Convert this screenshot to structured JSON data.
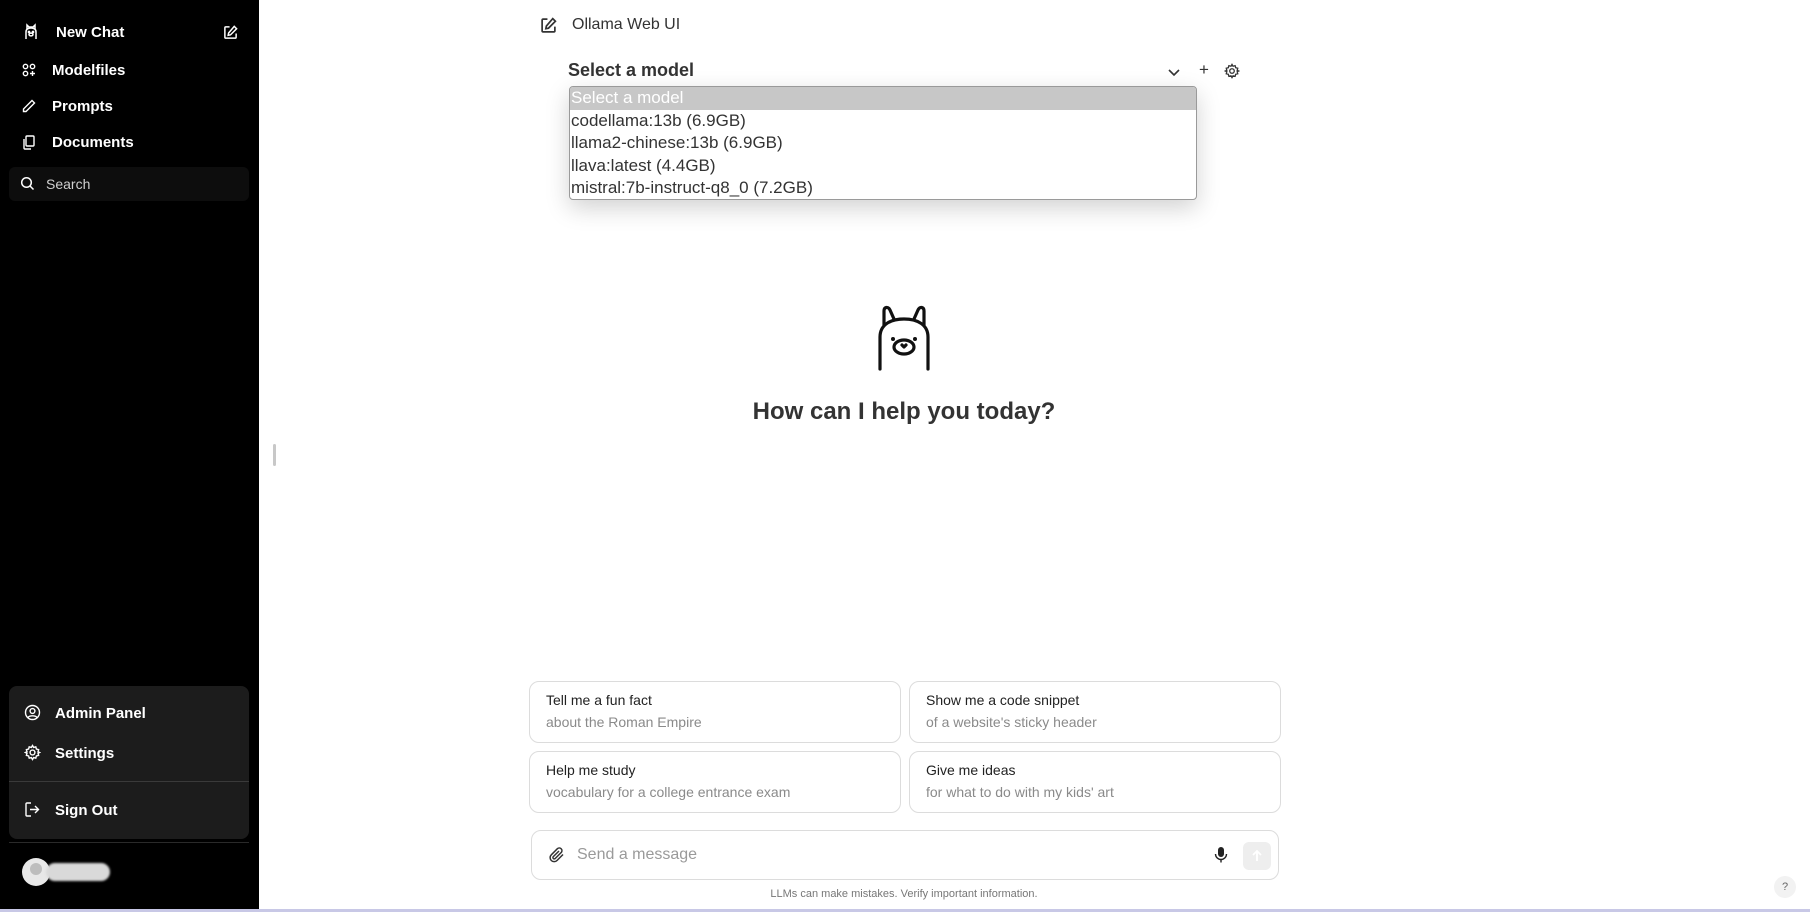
{
  "sidebar": {
    "new_chat": "New Chat",
    "items": [
      {
        "label": "Modelfiles"
      },
      {
        "label": "Prompts"
      },
      {
        "label": "Documents"
      }
    ],
    "search_placeholder": "Search",
    "user_menu": {
      "admin_panel": "Admin Panel",
      "settings": "Settings",
      "sign_out": "Sign Out"
    }
  },
  "header": {
    "title": "Ollama Web UI"
  },
  "model_selector": {
    "label": "Select a model",
    "options": [
      "Select a model",
      "codellama:13b (6.9GB)",
      "llama2-chinese:13b (6.9GB)",
      "llava:latest (4.4GB)",
      "mistral:7b-instruct-q8_0 (7.2GB)"
    ],
    "add": "+"
  },
  "greeting": "How can I help you today?",
  "suggestions": [
    {
      "title": "Tell me a fun fact",
      "subtitle": "about the Roman Empire"
    },
    {
      "title": "Show me a code snippet",
      "subtitle": "of a website's sticky header"
    },
    {
      "title": "Help me study",
      "subtitle": "vocabulary for a college entrance exam"
    },
    {
      "title": "Give me ideas",
      "subtitle": "for what to do with my kids' art"
    }
  ],
  "composer": {
    "placeholder": "Send a message"
  },
  "disclaimer": "LLMs can make mistakes. Verify important information.",
  "help": "?",
  "colors": {
    "sidebar_bg": "#000000",
    "user_menu_bg": "#1c1c1c",
    "selected_option_bg": "#c7c7c7"
  }
}
